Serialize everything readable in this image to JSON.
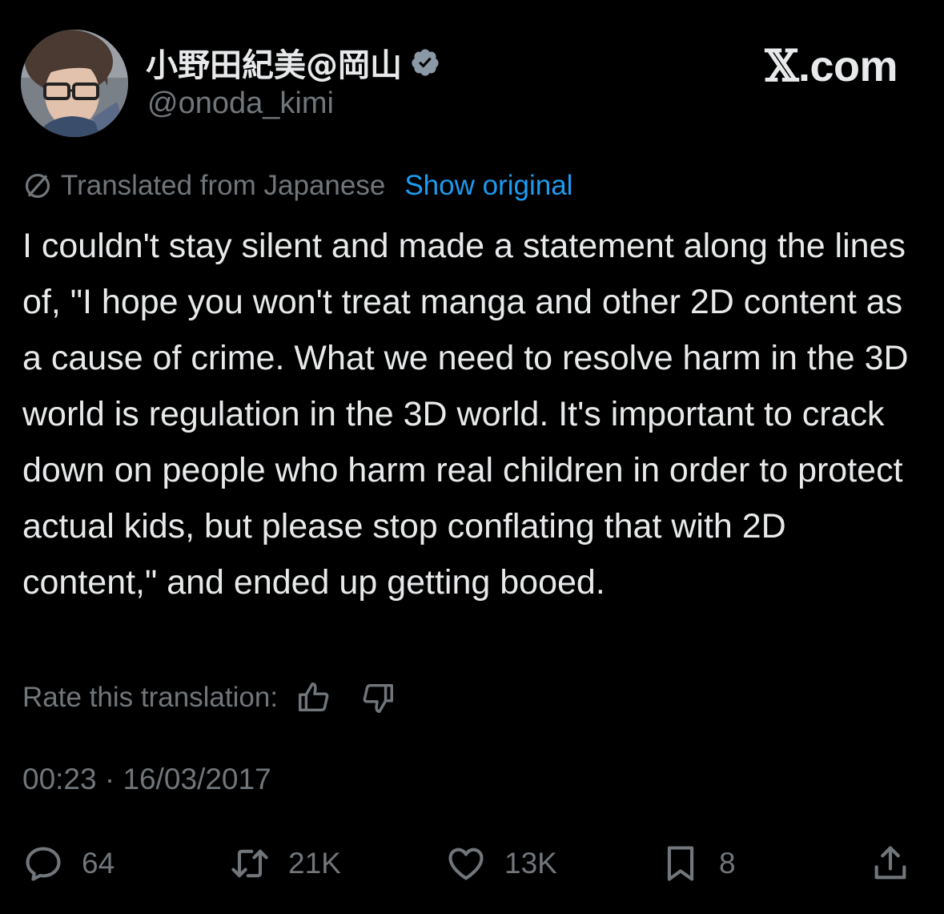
{
  "author": {
    "display_name": "小野田紀美@岡山",
    "handle": "@onoda_kimi",
    "verified_icon": "verified-badge-icon",
    "avatar": "profile-photo"
  },
  "brand": {
    "glyph": "𝕏",
    "suffix": ".com"
  },
  "translation": {
    "label": "Translated from Japanese",
    "show_original": "Show original",
    "icon": "translate-globe-icon"
  },
  "tweet": {
    "text": "I couldn't stay silent and made a statement along the lines of, \"I hope you won't treat manga and other 2D content as a cause of crime. What we need to resolve harm in the 3D world is regulation in the 3D world. It's important to crack down on people who harm real children in order to protect actual kids, but please stop conflating that with 2D content,\" and ended up getting booed."
  },
  "rate": {
    "label": "Rate this translation:",
    "thumbs_up_icon": "thumbs-up-icon",
    "thumbs_down_icon": "thumbs-down-icon"
  },
  "timestamp": {
    "time": "00:23",
    "separator": " · ",
    "date": "16/03/2017"
  },
  "actions": {
    "replies": "64",
    "reposts": "21K",
    "likes": "13K",
    "bookmarks": "8"
  },
  "colors": {
    "background": "#000000",
    "text": "#e7e9ea",
    "secondary": "#71767b",
    "link": "#1d9bf0"
  }
}
